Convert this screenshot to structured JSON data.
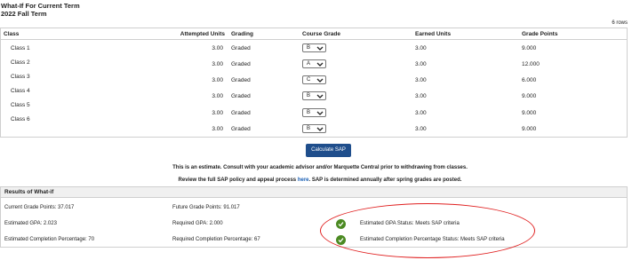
{
  "page": {
    "title_line1": "What-If For Current Term",
    "title_line2": "2022 Fall Term",
    "rows_count": "6 rows"
  },
  "table": {
    "headers": {
      "class": "Class",
      "attempted_units": "Attempted Units",
      "grading": "Grading",
      "course_grade": "Course Grade",
      "earned_units": "Earned Units",
      "grade_points": "Grade Points"
    },
    "class_names": [
      "Class 1",
      "Class 2",
      "Class 3",
      "Class 4",
      "Class 5",
      "Class 6"
    ],
    "rows": [
      {
        "attempted_units": "3.00",
        "grading": "Graded",
        "course_grade": "B",
        "earned_units": "3.00",
        "grade_points": "9.000"
      },
      {
        "attempted_units": "3.00",
        "grading": "Graded",
        "course_grade": "A",
        "earned_units": "3.00",
        "grade_points": "12.000"
      },
      {
        "attempted_units": "3.00",
        "grading": "Graded",
        "course_grade": "C",
        "earned_units": "3.00",
        "grade_points": "6.000"
      },
      {
        "attempted_units": "3.00",
        "grading": "Graded",
        "course_grade": "B",
        "earned_units": "3.00",
        "grade_points": "9.000"
      },
      {
        "attempted_units": "3.00",
        "grading": "Graded",
        "course_grade": "B",
        "earned_units": "3.00",
        "grade_points": "9.000"
      },
      {
        "attempted_units": "3.00",
        "grading": "Graded",
        "course_grade": "B",
        "earned_units": "3.00",
        "grade_points": "9.000"
      }
    ]
  },
  "calculate_button": "Calculate SAP",
  "notice": {
    "line1": "This is an estimate. Consult with your academic advisor and/or Marquette Central prior to withdrawing from classes.",
    "line2_before": "Review the full SAP policy and appeal process ",
    "line2_link": "here",
    "line2_after": ". SAP is determined annually after spring grades are posted."
  },
  "results": {
    "title": "Results of What-if",
    "current_grade_points": "Current Grade Points: 37.017",
    "future_grade_points": "Future Grade Points: 91.017",
    "estimated_gpa": "Estimated GPA:  2.023",
    "required_gpa": "Required GPA: 2.000",
    "gpa_status": "Estimated GPA Status: Meets SAP criteria",
    "estimated_completion": "Estimated Completion Percentage: 70",
    "required_completion": "Required Completion Percentage: 67",
    "completion_status": "Estimated Completion Percentage Status: Meets SAP criteria"
  },
  "colors": {
    "button": "#1f4e8c",
    "link": "#1a5fb4",
    "status_check": "#4b8a22",
    "annotation": "#e02020"
  }
}
